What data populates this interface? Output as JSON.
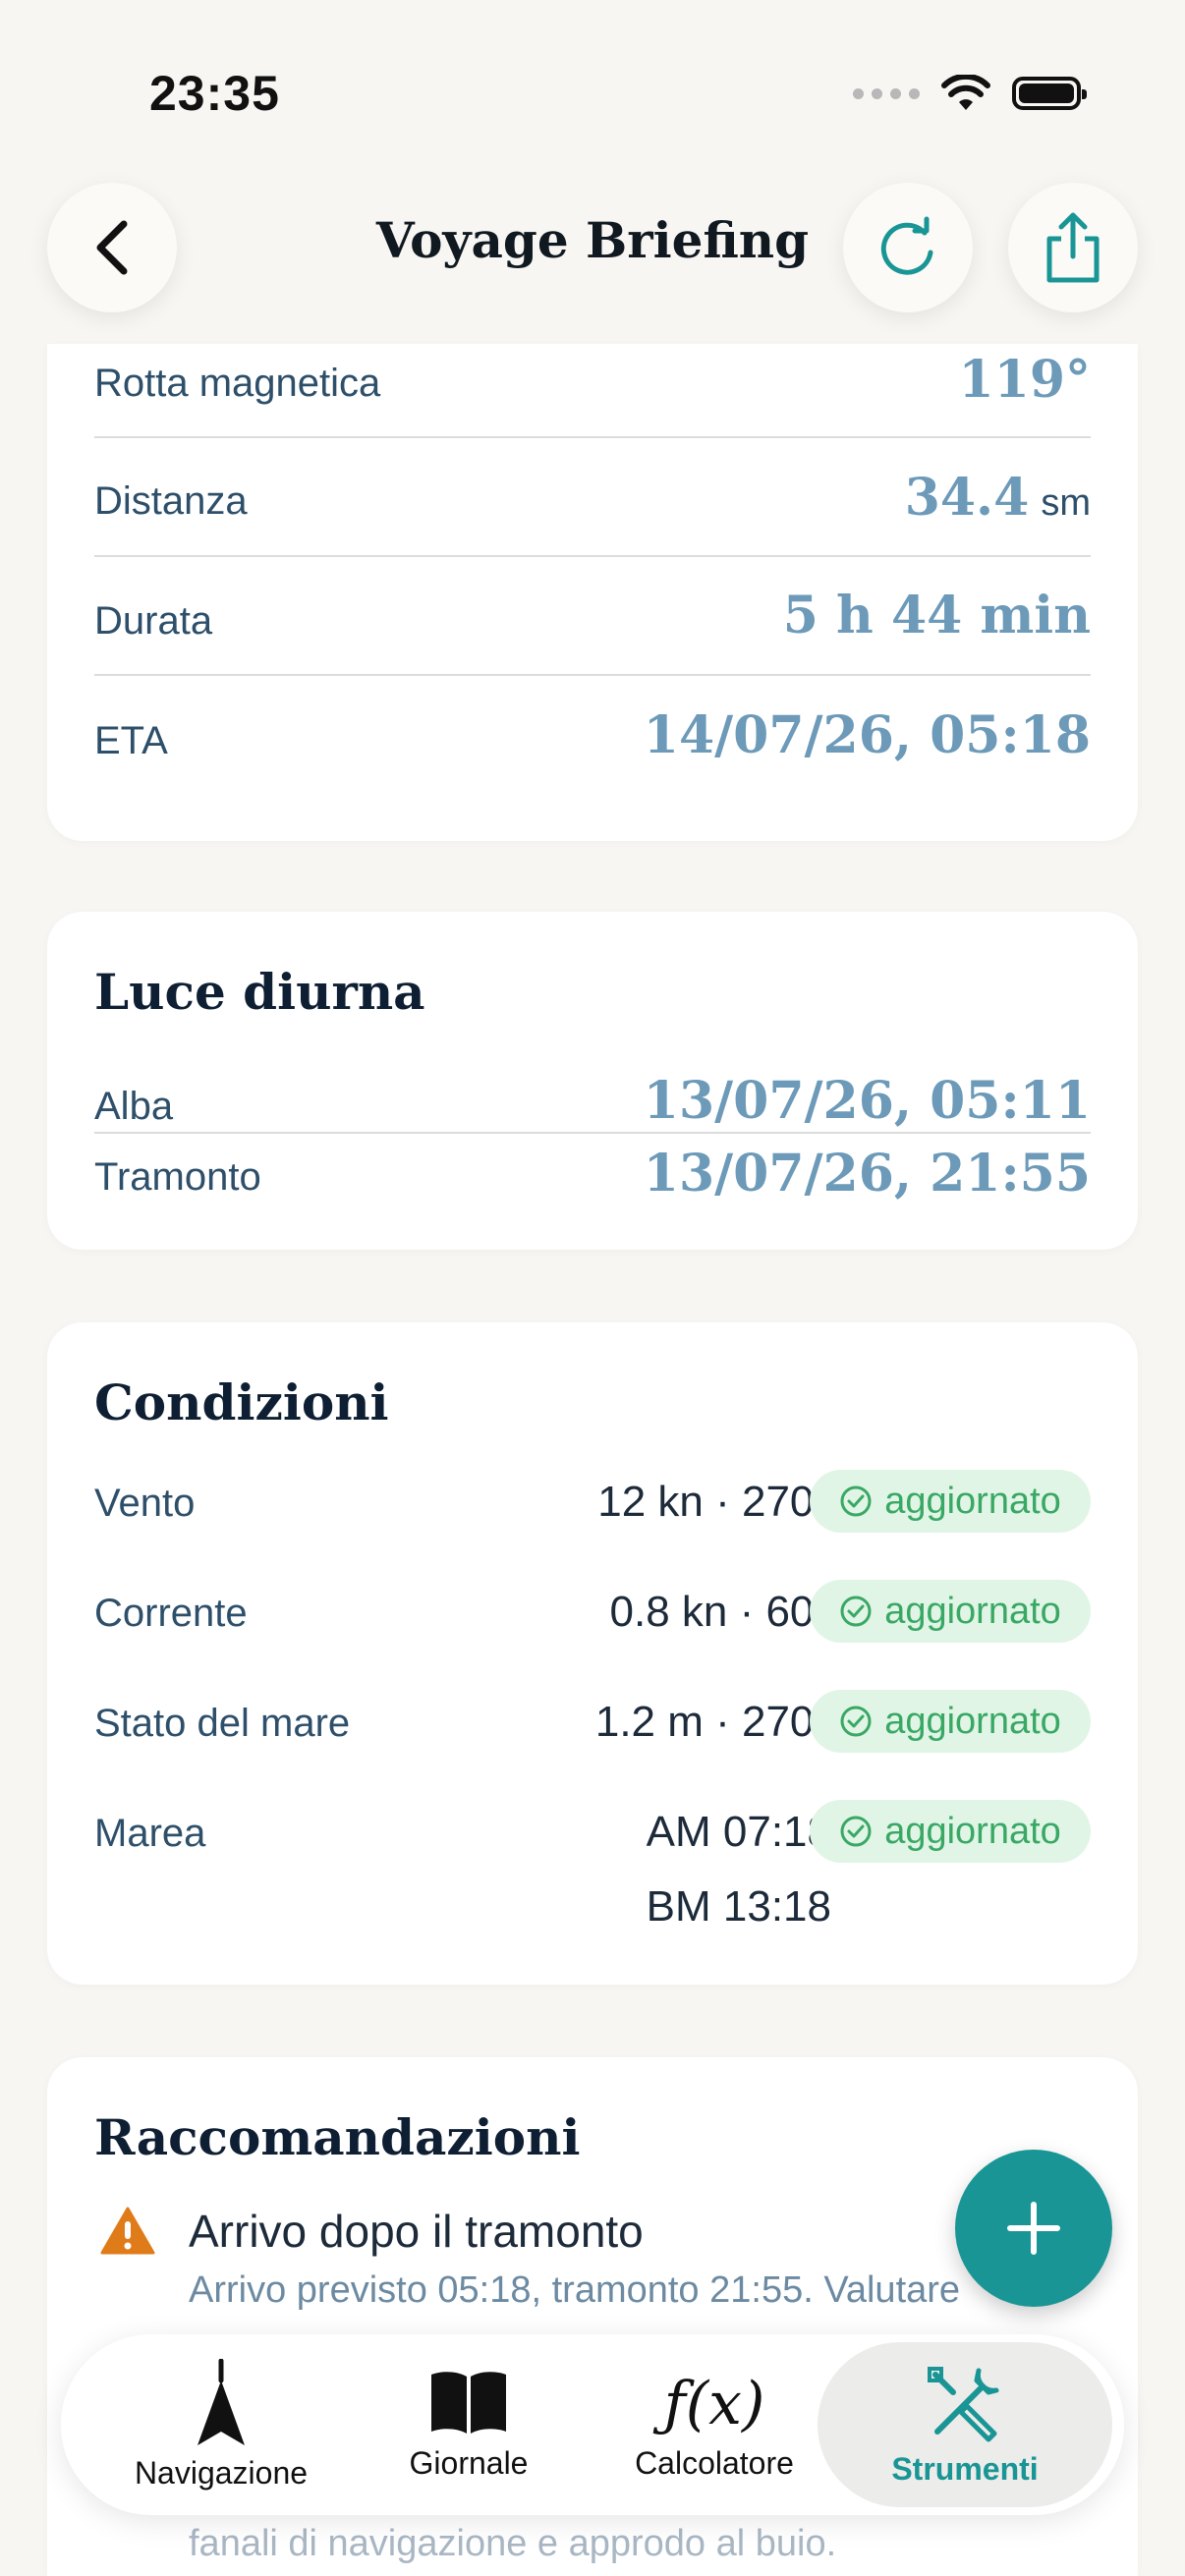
{
  "status_bar": {
    "time": "23:35"
  },
  "header": {
    "title": "Voyage Briefing"
  },
  "route": {
    "rows": [
      {
        "label": "Rotta magnetica",
        "value": "119°",
        "unit": ""
      },
      {
        "label": "Distanza",
        "value": "34.4",
        "unit": "sm"
      },
      {
        "label": "Durata",
        "value": "5 h 44 min",
        "unit": ""
      },
      {
        "label": "ETA",
        "value": "14/07/26, 05:18",
        "unit": ""
      }
    ]
  },
  "daylight": {
    "title": "Luce diurna",
    "rows": [
      {
        "label": "Alba",
        "value": "13/07/26, 05:11"
      },
      {
        "label": "Tramonto",
        "value": "13/07/26, 21:55"
      }
    ]
  },
  "conditions": {
    "title": "Condizioni",
    "rows": [
      {
        "label": "Vento",
        "value": "12 kn · 270°",
        "badge": "aggiornato"
      },
      {
        "label": "Corrente",
        "value": "0.8 kn · 60°",
        "badge": "aggiornato"
      },
      {
        "label": "Stato del mare",
        "value": "1.2 m · 270°",
        "badge": "aggiornato"
      },
      {
        "label": "Marea",
        "value": "AM 07:18",
        "value2": "BM 13:18",
        "badge": "aggiornato"
      }
    ]
  },
  "recommendations": {
    "title": "Raccomandazioni",
    "items": [
      {
        "title": "Arrivo dopo il tramonto",
        "description": "Arrivo previsto 05:18, tramonto 21:55. Valutare",
        "description_tail": "fanali di navigazione e approdo al buio."
      }
    ]
  },
  "tabbar": {
    "tabs": [
      {
        "label": "Navigazione",
        "icon": "navigation-arrow-icon"
      },
      {
        "label": "Giornale",
        "icon": "book-icon"
      },
      {
        "label": "Calcolatore",
        "icon": "function-icon",
        "glyph": "ƒ(x)"
      },
      {
        "label": "Strumenti",
        "icon": "tools-icon",
        "active": true
      }
    ]
  },
  "colors": {
    "accent": "#1a9595",
    "value": "#6c9ab8",
    "badge_bg": "#e1f5e6",
    "badge_text": "#3aa865",
    "warning": "#e07b1a"
  }
}
